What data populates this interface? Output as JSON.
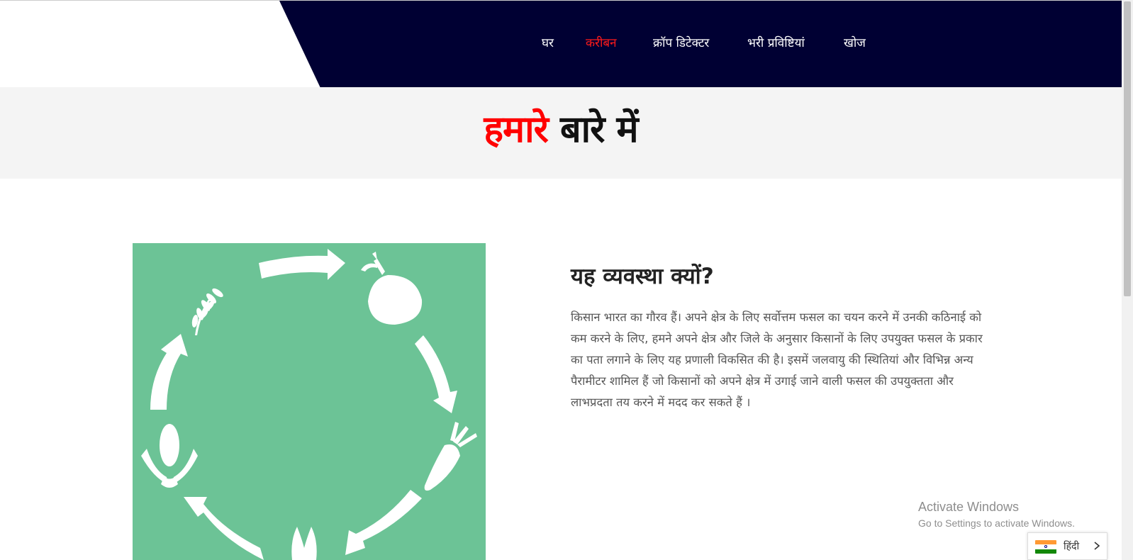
{
  "nav": {
    "items": [
      {
        "label": "घर",
        "active": false
      },
      {
        "label": "करीबन",
        "active": true
      },
      {
        "label": "क्रॉप डिटेक्टर",
        "active": false
      },
      {
        "label": "भरी प्रविष्टियां",
        "active": false
      },
      {
        "label": "खोज",
        "active": false
      }
    ]
  },
  "hero": {
    "title_highlight": "हमारे",
    "title_rest": " बारे में"
  },
  "section": {
    "title": "यह व्यवस्था क्यों?",
    "body": "किसान भारत का गौरव हैं। अपने क्षेत्र के लिए सर्वोत्तम फसल का चयन करने में उनकी कठिनाई को कम करने के लिए, हमने अपने क्षेत्र और जिले के अनुसार किसानों के लिए उपयुक्त फसल के प्रकार का पता लगाने के लिए यह प्रणाली विकसित की है। इसमें जलवायु की स्थितियां और विभिन्न अन्य पैरामीटर शामिल हैं जो किसानों को अपने क्षेत्र में उगाई जाने वाली फसल की उपयुक्तता और लाभप्रदता तय करने में मदद कर सकते हैं ।"
  },
  "watermark": {
    "title": "Activate Windows",
    "subtitle": "Go to Settings to activate Windows."
  },
  "language": {
    "label": "हिंदी",
    "flag": "india-flag-icon"
  },
  "colors": {
    "navy": "#000033",
    "accent_red": "#ff0000",
    "panel_green": "#6cc396"
  }
}
